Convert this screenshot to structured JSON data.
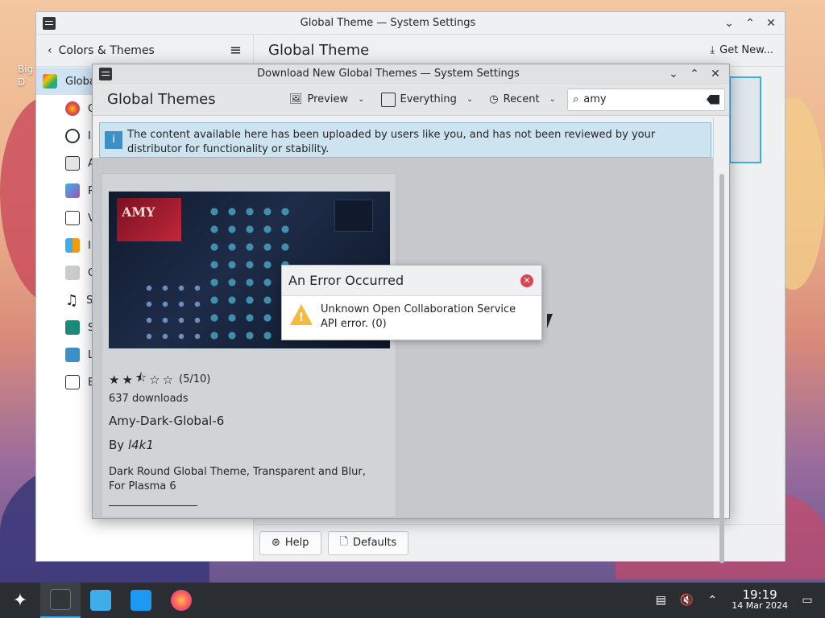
{
  "desktop": {
    "label_line1": "Big",
    "label_line2": "D"
  },
  "main_window": {
    "title": "Global Theme — System Settings",
    "back_label": "Colors & Themes",
    "page_title": "Global Theme",
    "get_new_label": "Get New...",
    "sidebar": [
      {
        "label": "Globa",
        "active": true
      },
      {
        "label": "C"
      },
      {
        "label": "I"
      },
      {
        "label": "A"
      },
      {
        "label": "P"
      },
      {
        "label": "V"
      },
      {
        "label": "I"
      },
      {
        "label": "C"
      },
      {
        "label": "S"
      },
      {
        "label": "S"
      },
      {
        "label": "L"
      },
      {
        "label": "B"
      }
    ],
    "footer": {
      "help_label": "Help",
      "defaults_label": "Defaults"
    }
  },
  "dialog": {
    "title": "Download New Global Themes — System Settings",
    "header_title": "Global Themes",
    "view_label": "Preview",
    "filter_label": "Everything",
    "sort_label": "Recent",
    "search_value": "amy",
    "notice": "The content available here has been uploaded by users like you, and has not been reviewed by your distributor for functionality or stability.",
    "card": {
      "rating_text": "(5/10)",
      "rating_value": 5,
      "downloads": "637 downloads",
      "name": "Amy-Dark-Global-6",
      "author_prefix": "By",
      "author": "l4k1",
      "description": "Dark Round Global Theme, Transparent and Blur, For Plasma 6",
      "preview_text": "AMY"
    }
  },
  "error": {
    "title": "An Error Occurred",
    "message": "Unknown Open Collaboration Service API error. (0)"
  },
  "taskbar": {
    "time": "19:19",
    "date": "14 Mar 2024"
  },
  "colors": {
    "accent": "#3daee9",
    "error_red": "#da4453",
    "warning": "#f6b93b",
    "taskbar": "#2a2e32"
  }
}
